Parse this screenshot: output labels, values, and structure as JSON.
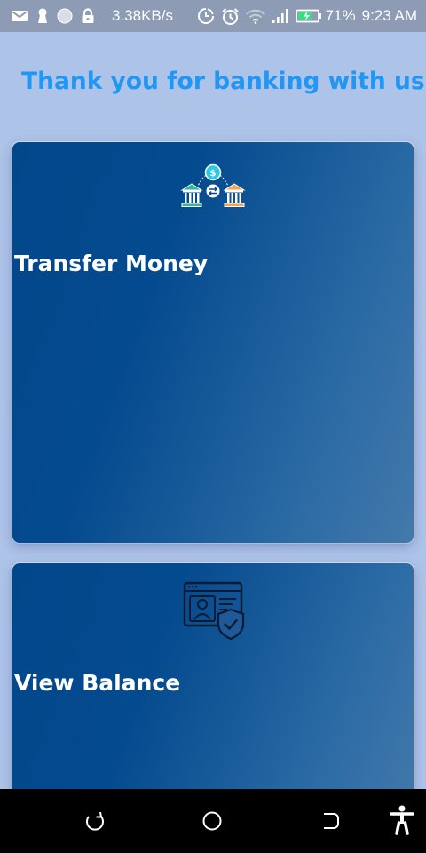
{
  "status_bar": {
    "icons_left": [
      "gmail-icon",
      "keyhole-icon",
      "circle-icon",
      "lock-icon"
    ],
    "network_speed": "3.38KB/s",
    "icons_right": [
      "data-saver-icon",
      "alarm-icon",
      "wifi-icon",
      "signal-icon",
      "battery-charging-icon"
    ],
    "battery_percent": "71%",
    "time": "9:23 AM"
  },
  "header": {
    "title": "Thank you for banking with us"
  },
  "cards": [
    {
      "label": "Transfer Money",
      "icon": "bank-transfer-icon"
    },
    {
      "label": "View Balance",
      "icon": "account-secure-icon"
    }
  ],
  "nav_bar": {
    "icons": [
      "recent-apps-icon",
      "home-icon",
      "back-icon",
      "accessibility-icon"
    ]
  },
  "colors": {
    "background": "#aec3e8",
    "status_bar": "#8d9bb5",
    "title": "#2196f3",
    "card_gradient_start": "#03478b",
    "card_gradient_end": "#4479ab",
    "card_text": "#ffffff",
    "nav_bar": "#000000",
    "icon_teal": "#2cb89a",
    "icon_orange": "#f6a54c",
    "icon_cyan": "#2ec7e8"
  }
}
